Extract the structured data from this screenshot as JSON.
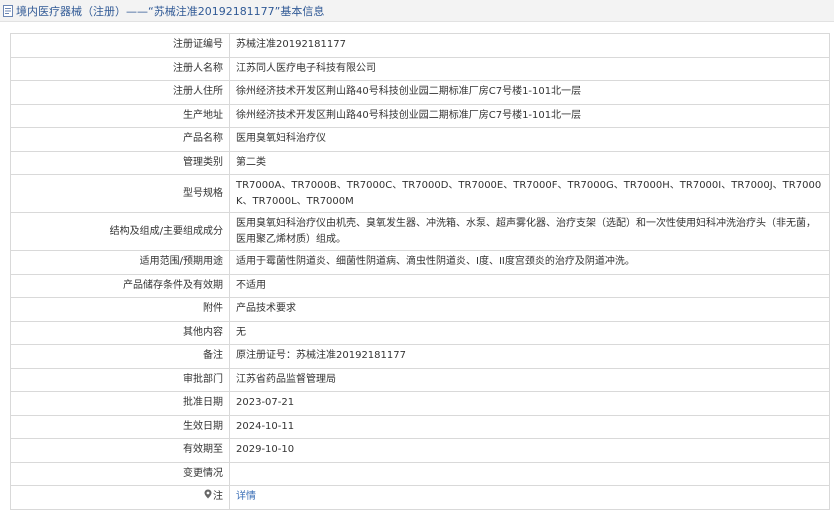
{
  "header": {
    "title": "境内医疗器械（注册）——“苏械注准20192181177”基本信息"
  },
  "rows": [
    {
      "label": "注册证编号",
      "value": "苏械注准20192181177"
    },
    {
      "label": "注册人名称",
      "value": "江苏同人医疗电子科技有限公司"
    },
    {
      "label": "注册人住所",
      "value": "徐州经济技术开发区荆山路40号科技创业园二期标准厂房C7号楼1-101北一层"
    },
    {
      "label": "生产地址",
      "value": "徐州经济技术开发区荆山路40号科技创业园二期标准厂房C7号楼1-101北一层"
    },
    {
      "label": "产品名称",
      "value": "医用臭氧妇科治疗仪"
    },
    {
      "label": "管理类别",
      "value": "第二类"
    },
    {
      "label": "型号规格",
      "value": "TR7000A、TR7000B、TR7000C、TR7000D、TR7000E、TR7000F、TR7000G、TR7000H、TR7000I、TR7000J、TR7000K、TR7000L、TR7000M"
    },
    {
      "label": "结构及组成/主要组成成分",
      "value": "医用臭氧妇科治疗仪由机壳、臭氧发生器、冲洗箱、水泵、超声雾化器、治疗支架（选配）和一次性使用妇科冲洗治疗头（非无菌，医用聚乙烯材质）组成。"
    },
    {
      "label": "适用范围/预期用途",
      "value": "适用于霉菌性阴道炎、细菌性阴道病、滴虫性阴道炎、I度、II度宫颈炎的治疗及阴道冲洗。"
    },
    {
      "label": "产品储存条件及有效期",
      "value": "不适用"
    },
    {
      "label": "附件",
      "value": "产品技术要求"
    },
    {
      "label": "其他内容",
      "value": "无"
    },
    {
      "label": "备注",
      "value": "原注册证号：苏械注准20192181177"
    },
    {
      "label": "审批部门",
      "value": "江苏省药品监督管理局"
    },
    {
      "label": "批准日期",
      "value": "2023-07-21"
    },
    {
      "label": "生效日期",
      "value": "2024-10-11"
    },
    {
      "label": "有效期至",
      "value": "2029-10-10"
    },
    {
      "label": "变更情况",
      "value": ""
    }
  ],
  "note_row": {
    "label": "注",
    "link": "详情"
  },
  "colors": {
    "header_text": "#315a96",
    "link": "#3b6fb6",
    "border": "#d9d9d9"
  }
}
